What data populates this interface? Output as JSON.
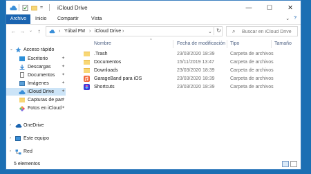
{
  "window": {
    "title": "iCloud Drive",
    "controls": {
      "minimize": "—",
      "maximize": "☐",
      "close": "✕"
    }
  },
  "ribbon": {
    "tabs": [
      "Archivo",
      "Inicio",
      "Compartir",
      "Vista"
    ],
    "expand_glyph": "⌄",
    "help_glyph": "?"
  },
  "nav": {
    "back": "←",
    "forward": "→",
    "recent": "⌄",
    "up": "↑"
  },
  "address": {
    "crumbs": [
      "Yúbal FM",
      "iCloud Drive"
    ],
    "separator": "›",
    "dropdown_glyph": "⌄",
    "refresh_glyph": "↻"
  },
  "search": {
    "placeholder": "Buscar en iCloud Drive",
    "icon_glyph": "⌕"
  },
  "sidebar": {
    "quick_access": "Acceso rápido",
    "items": [
      {
        "label": "Escritorio",
        "pinned": true,
        "icon": "desktop-icon"
      },
      {
        "label": "Descargas",
        "pinned": true,
        "icon": "download-icon"
      },
      {
        "label": "Documentos",
        "pinned": true,
        "icon": "documents-icon"
      },
      {
        "label": "Imágenes",
        "pinned": true,
        "icon": "pictures-icon"
      },
      {
        "label": "iCloud Drive",
        "pinned": true,
        "selected": true,
        "icon": "icloud-icon"
      },
      {
        "label": "Capturas de pan",
        "pinned": true,
        "icon": "folder-icon"
      },
      {
        "label": "Fotos en iCloud",
        "pinned": true,
        "icon": "photos-icon"
      }
    ],
    "onedrive": "OneDrive",
    "this_pc": "Este equipo",
    "network": "Red",
    "pin_glyph": "📌",
    "expand_glyph": "›",
    "expanded_glyph": "⌄"
  },
  "columns": {
    "name": "Nombre",
    "date": "Fecha de modificación",
    "type": "Tipo",
    "size": "Tamaño",
    "sort_glyph": "^"
  },
  "files": [
    {
      "name": ".Trash",
      "date": "23/03/2020 18:39",
      "type": "Carpeta de archivos",
      "icon": "folder-icon"
    },
    {
      "name": "Documentos",
      "date": "15/11/2019 13:47",
      "type": "Carpeta de archivos",
      "icon": "folder-icon"
    },
    {
      "name": "Downloads",
      "date": "23/03/2020 18:39",
      "type": "Carpeta de archivos",
      "icon": "folder-icon"
    },
    {
      "name": "GarageBand para iOS",
      "date": "23/03/2020 18:39",
      "type": "Carpeta de archivos",
      "icon": "garageband-icon"
    },
    {
      "name": "Shortcuts",
      "date": "23/03/2020 18:39",
      "type": "Carpeta de archivos",
      "icon": "shortcuts-icon"
    }
  ],
  "status": {
    "count": "5 elementos"
  },
  "colors": {
    "accent": "#1a64b0",
    "selection": "#cce4f7",
    "folder": "#f8d775"
  }
}
